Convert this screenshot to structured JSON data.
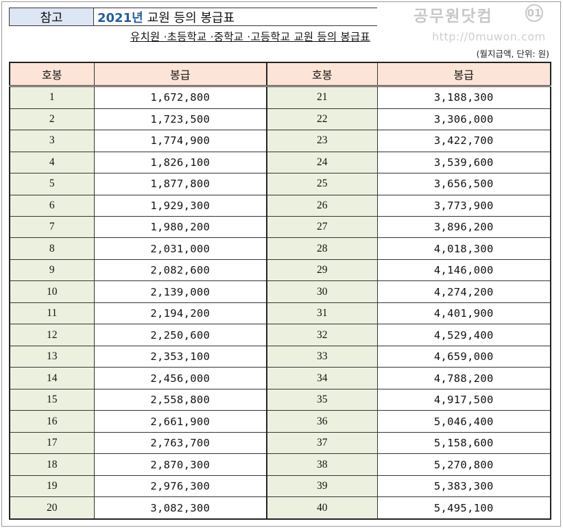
{
  "header": {
    "ref_label": "참고",
    "title_year": "2021년",
    "title_rest": "교원 등의 봉급표",
    "subtitle": "유치원 ·초등학교 ·중학교 ·고등학교 교원 등의 봉급표",
    "unit_note": "(월지급액, 단위: 원)"
  },
  "watermark": {
    "brand": "공무원닷컴",
    "badge": "01",
    "url": "http://0muwon.com"
  },
  "table": {
    "headers": [
      "호봉",
      "봉급",
      "호봉",
      "봉급"
    ],
    "rows": [
      {
        "s1": "1",
        "p1": "1,672,800",
        "s2": "21",
        "p2": "3,188,300"
      },
      {
        "s1": "2",
        "p1": "1,723,500",
        "s2": "22",
        "p2": "3,306,000"
      },
      {
        "s1": "3",
        "p1": "1,774,900",
        "s2": "23",
        "p2": "3,422,700"
      },
      {
        "s1": "4",
        "p1": "1,826,100",
        "s2": "24",
        "p2": "3,539,600"
      },
      {
        "s1": "5",
        "p1": "1,877,800",
        "s2": "25",
        "p2": "3,656,500"
      },
      {
        "s1": "6",
        "p1": "1,929,300",
        "s2": "26",
        "p2": "3,773,900"
      },
      {
        "s1": "7",
        "p1": "1,980,200",
        "s2": "27",
        "p2": "3,896,200"
      },
      {
        "s1": "8",
        "p1": "2,031,000",
        "s2": "28",
        "p2": "4,018,300"
      },
      {
        "s1": "9",
        "p1": "2,082,600",
        "s2": "29",
        "p2": "4,146,000"
      },
      {
        "s1": "10",
        "p1": "2,139,000",
        "s2": "30",
        "p2": "4,274,200"
      },
      {
        "s1": "11",
        "p1": "2,194,200",
        "s2": "31",
        "p2": "4,401,900"
      },
      {
        "s1": "12",
        "p1": "2,250,600",
        "s2": "32",
        "p2": "4,529,400"
      },
      {
        "s1": "13",
        "p1": "2,353,100",
        "s2": "33",
        "p2": "4,659,000"
      },
      {
        "s1": "14",
        "p1": "2,456,000",
        "s2": "34",
        "p2": "4,788,200"
      },
      {
        "s1": "15",
        "p1": "2,558,800",
        "s2": "35",
        "p2": "4,917,500"
      },
      {
        "s1": "16",
        "p1": "2,661,900",
        "s2": "36",
        "p2": "5,046,400"
      },
      {
        "s1": "17",
        "p1": "2,763,700",
        "s2": "37",
        "p2": "5,158,600"
      },
      {
        "s1": "18",
        "p1": "2,870,300",
        "s2": "38",
        "p2": "5,270,800"
      },
      {
        "s1": "19",
        "p1": "2,976,300",
        "s2": "39",
        "p2": "5,383,300"
      },
      {
        "s1": "20",
        "p1": "3,082,300",
        "s2": "40",
        "p2": "5,495,100"
      }
    ]
  },
  "colors": {
    "header_fill": "#fce4d6",
    "step_fill": "#ebf1de",
    "ref_fill": "#dce6f4",
    "year_color": "#1f5f9f"
  }
}
